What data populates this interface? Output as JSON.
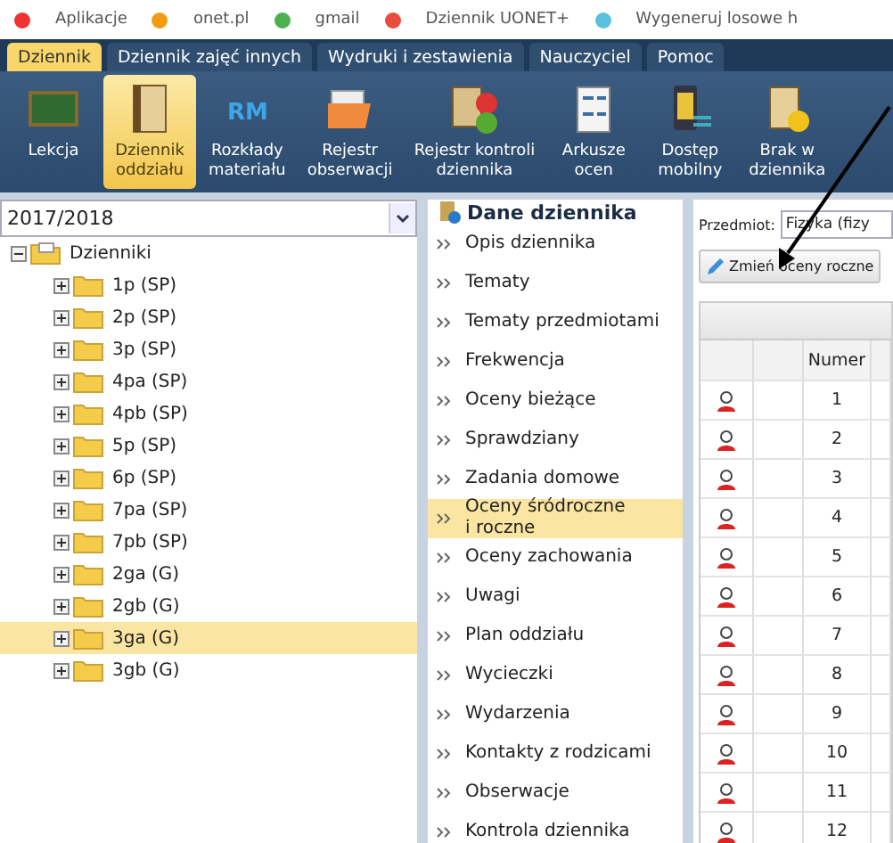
{
  "bookmarks": [
    "Aplikacje",
    "onet.pl",
    "gmail",
    "Dziennik UONET+",
    "Wygeneruj losowe h"
  ],
  "tabs": [
    {
      "label": "Dziennik",
      "selected": true
    },
    {
      "label": "Dziennik zajęć innych",
      "selected": false
    },
    {
      "label": "Wydruki i zestawienia",
      "selected": false
    },
    {
      "label": "Nauczyciel",
      "selected": false
    },
    {
      "label": "Pomoc",
      "selected": false
    }
  ],
  "toolbar": [
    {
      "kind": "board",
      "lines": [
        "Lekcja"
      ],
      "selected": false
    },
    {
      "kind": "book",
      "lines": [
        "Dziennik",
        "oddziału"
      ],
      "selected": true
    },
    {
      "kind": "rm",
      "lines": [
        "Rozkłady",
        "materiału"
      ],
      "selected": false,
      "icon_text": "RM"
    },
    {
      "kind": "folder",
      "lines": [
        "Rejestr",
        "obserwacji"
      ],
      "selected": false
    },
    {
      "kind": "check",
      "lines": [
        "Rejestr kontroli",
        "dziennika"
      ],
      "selected": false
    },
    {
      "kind": "sheet",
      "lines": [
        "Arkusze",
        "ocen"
      ],
      "selected": false
    },
    {
      "kind": "phone",
      "lines": [
        "Dostęp",
        "mobilny"
      ],
      "selected": false
    },
    {
      "kind": "warn",
      "lines": [
        "Brak w",
        "dziennika"
      ],
      "selected": false
    }
  ],
  "year_select": {
    "value": "2017/2018"
  },
  "tree": [
    {
      "label": "Dzienniki",
      "expanded": true,
      "selected": false,
      "children": [
        {
          "label": "1p (SP)",
          "expanded": false,
          "selected": false
        },
        {
          "label": "2p (SP)",
          "expanded": false,
          "selected": false
        },
        {
          "label": "3p (SP)",
          "expanded": false,
          "selected": false
        },
        {
          "label": "4pa (SP)",
          "expanded": false,
          "selected": false
        },
        {
          "label": "4pb (SP)",
          "expanded": false,
          "selected": false
        },
        {
          "label": "5p (SP)",
          "expanded": false,
          "selected": false
        },
        {
          "label": "6p (SP)",
          "expanded": false,
          "selected": false
        },
        {
          "label": "7pa (SP)",
          "expanded": false,
          "selected": false
        },
        {
          "label": "7pb (SP)",
          "expanded": false,
          "selected": false
        },
        {
          "label": "2ga (G)",
          "expanded": false,
          "selected": false
        },
        {
          "label": "2gb (G)",
          "expanded": false,
          "selected": false
        },
        {
          "label": "3ga (G)",
          "expanded": false,
          "selected": true
        },
        {
          "label": "3gb (G)",
          "expanded": false,
          "selected": false
        }
      ]
    }
  ],
  "nav": {
    "title": "Dane dziennika",
    "items": [
      {
        "label": "Opis dziennika",
        "selected": false
      },
      {
        "label": "Tematy",
        "selected": false
      },
      {
        "label": "Tematy przedmiotami",
        "selected": false
      },
      {
        "label": "Frekwencja",
        "selected": false
      },
      {
        "label": "Oceny bieżące",
        "selected": false
      },
      {
        "label": "Sprawdziany",
        "selected": false
      },
      {
        "label": "Zadania domowe",
        "selected": false
      },
      {
        "label": "Oceny śródroczne\ni roczne",
        "selected": true
      },
      {
        "label": "Oceny zachowania",
        "selected": false
      },
      {
        "label": "Uwagi",
        "selected": false
      },
      {
        "label": "Plan oddziału",
        "selected": false
      },
      {
        "label": "Wycieczki",
        "selected": false
      },
      {
        "label": "Wydarzenia",
        "selected": false
      },
      {
        "label": "Kontakty z rodzicami",
        "selected": false
      },
      {
        "label": "Obserwacje",
        "selected": false
      },
      {
        "label": "Kontrola dziennika",
        "selected": false
      }
    ]
  },
  "subject": {
    "label": "Przedmiot:",
    "value": "Fizyka (fizy"
  },
  "edit_button": {
    "label": "Zmień oceny roczne"
  },
  "table": {
    "columns": [
      "",
      "",
      "Numer"
    ],
    "rows": [
      "1",
      "2",
      "3",
      "4",
      "5",
      "6",
      "7",
      "8",
      "9",
      "10",
      "11",
      "12"
    ]
  }
}
